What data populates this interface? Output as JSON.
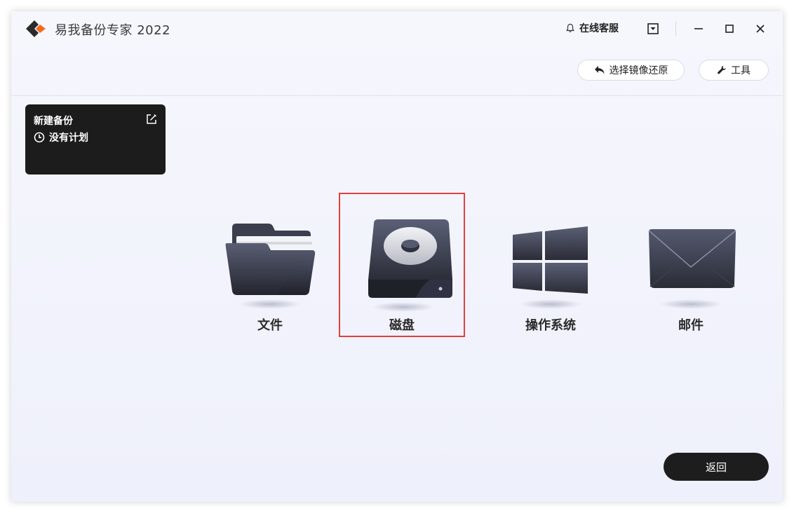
{
  "app": {
    "title": "易我备份专家 2022"
  },
  "titlebar": {
    "support_label": "在线客服"
  },
  "toolbar": {
    "restore_label": "选择镜像还原",
    "tools_label": "工具"
  },
  "backup_card": {
    "title": "新建备份",
    "plan": "没有计划"
  },
  "options": [
    {
      "label": "文件",
      "icon": "folder-icon",
      "selected": false
    },
    {
      "label": "磁盘",
      "icon": "disk-icon",
      "selected": true
    },
    {
      "label": "操作系统",
      "icon": "windows-icon",
      "selected": false
    },
    {
      "label": "邮件",
      "icon": "mail-icon",
      "selected": false
    }
  ],
  "footer": {
    "return_label": "返回"
  },
  "colors": {
    "accent_orange": "#f26a1b",
    "selection_red": "#e0403e",
    "dark": "#1d1d1d"
  }
}
